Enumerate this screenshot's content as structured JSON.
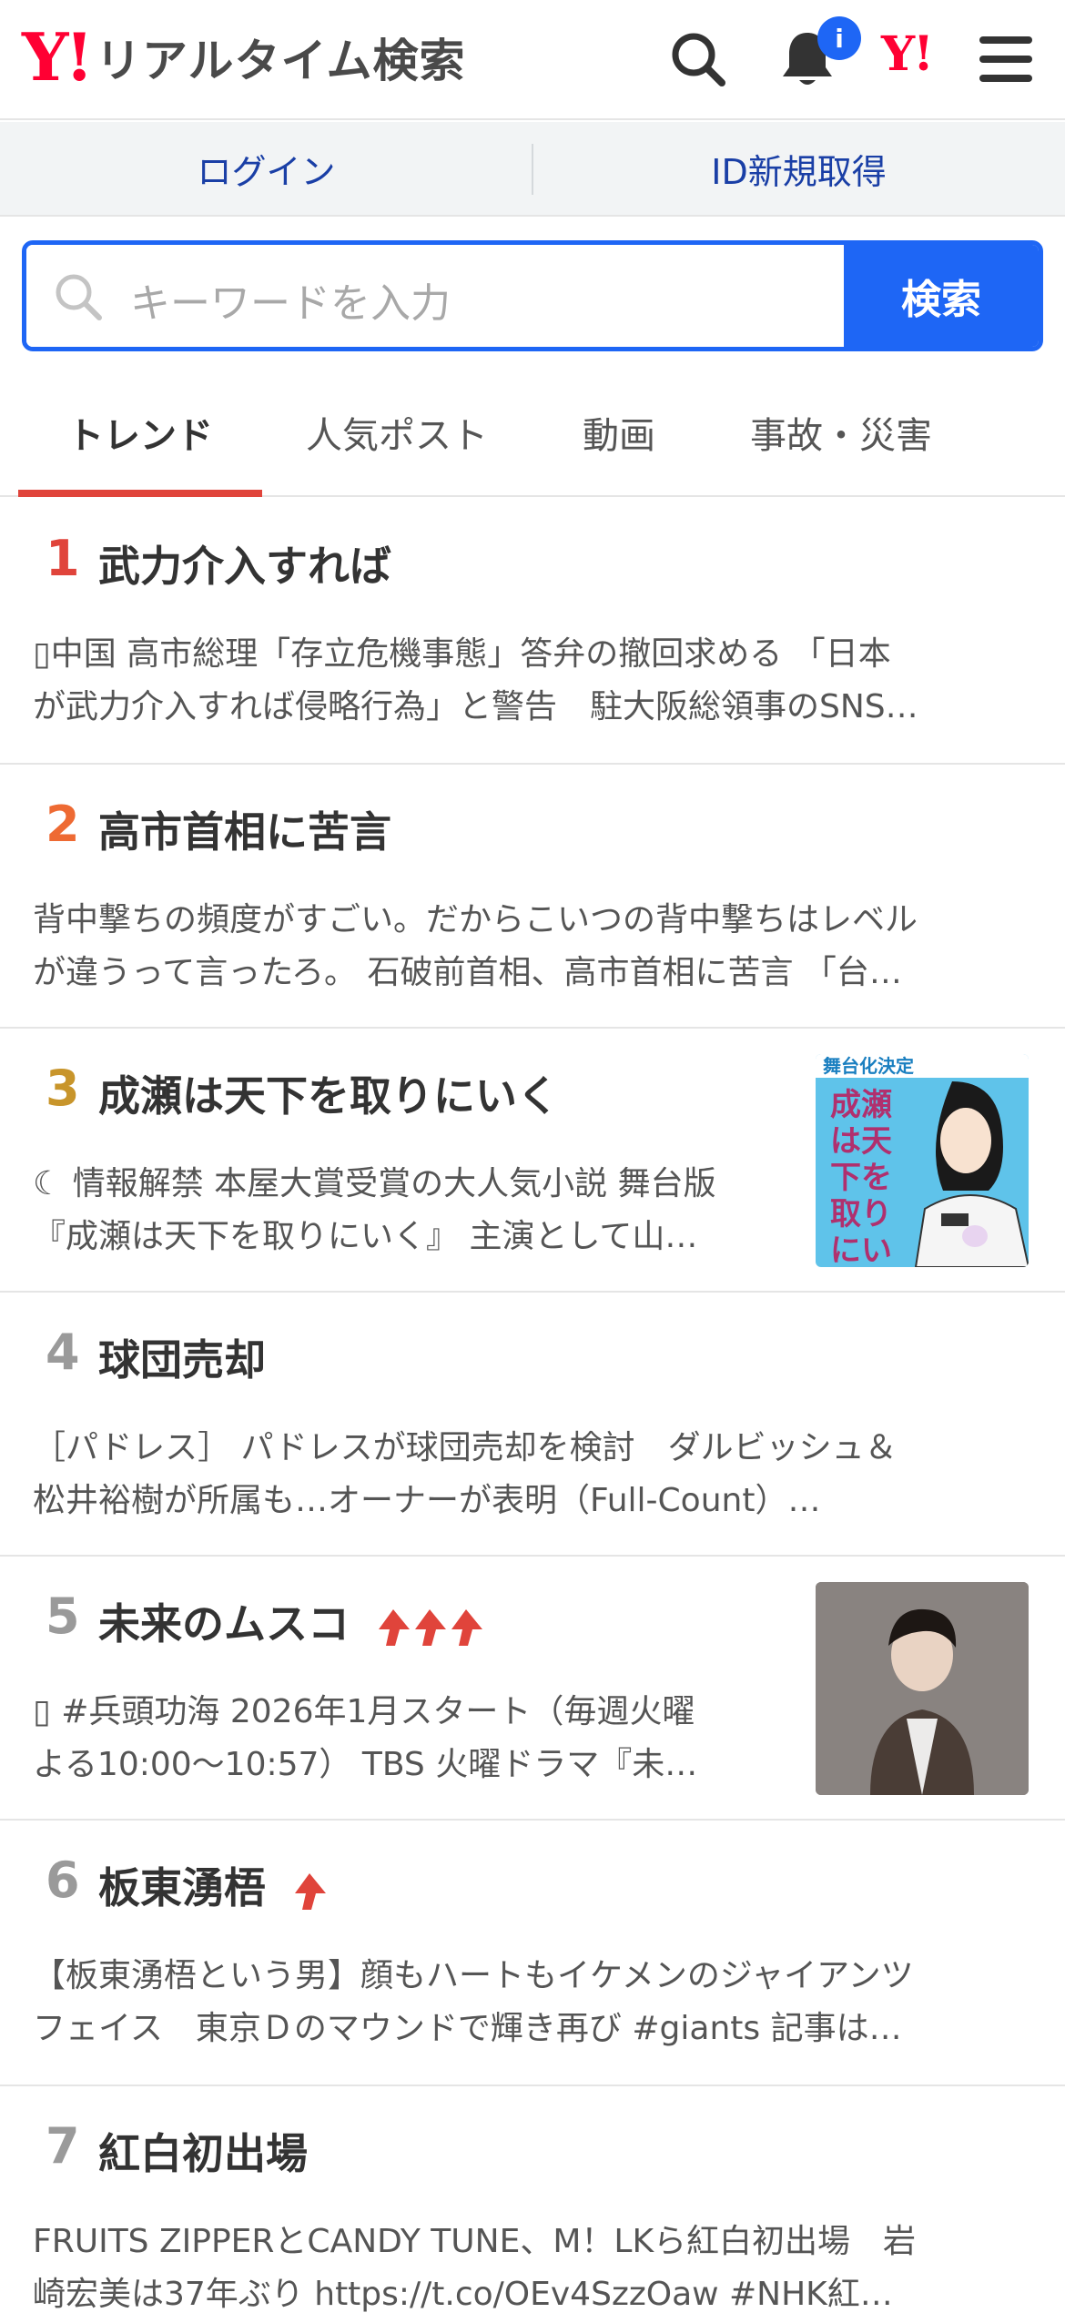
{
  "header": {
    "logo_mark": "Y!",
    "logo_text": "リアルタイム検索",
    "notification_badge": "i",
    "yahoo_mark": "Y!"
  },
  "account": {
    "login": "ログイン",
    "signup": "ID新規取得"
  },
  "search": {
    "placeholder": "キーワードを入力",
    "button": "検索"
  },
  "tabs": [
    {
      "label": "トレンド",
      "active": true
    },
    {
      "label": "人気ポスト"
    },
    {
      "label": "動画"
    },
    {
      "label": "事故・災害"
    }
  ],
  "colors": {
    "accent_blue": "#1e66f5",
    "rank1": "#e0443b",
    "rank2": "#ee6a33",
    "rank3": "#c8952b",
    "rank_default": "#9a9a9a",
    "arrow_red": "#e0443b"
  },
  "trends": [
    {
      "rank": "1",
      "title": "武力介入すれば",
      "line1": "▯中国 高市総理「存立危機事態」答弁の撤回求める 「日本",
      "line2": "が武力介入すれば侵略行為」と警告　駐大阪総領事のSNS…"
    },
    {
      "rank": "2",
      "title": "高市首相に苦言",
      "line1": "背中撃ちの頻度がすごい。だからこいつの背中撃ちはレベル",
      "line2": "が違うって言ったろ。 石破前首相、高市首相に苦言 「台…"
    },
    {
      "rank": "3",
      "title": "成瀬は天下を取りにいく",
      "line1": "☾ 情報解禁 本屋大賞受賞の大人気小説 舞台版",
      "line2": "『成瀬は天下を取りにいく』 主演として山…",
      "thumb_caption": "舞台化決定",
      "thumb_title": "成瀬は天下を取りにいく"
    },
    {
      "rank": "4",
      "title": "球団売却",
      "line1": "［パドレス］ パドレスが球団売却を検討　ダルビッシュ＆",
      "line2": "松井裕樹が所属も…オーナーが表明（Full-Count）…"
    },
    {
      "rank": "5",
      "title": "未来のムスコ",
      "trend_arrows": 3,
      "line1": "▯ #兵頭功海 2026年1月スタート（毎週火曜",
      "line2": "よる10:00〜10:57） TBS 火曜ドラマ『未…"
    },
    {
      "rank": "6",
      "title": "板東湧梧",
      "trend_arrows": 1,
      "line1": "【板東湧梧という男】顔もハートもイケメンのジャイアンツ",
      "line2": "フェイス　東京Ｄのマウンドで輝き再び #giants 記事は…"
    },
    {
      "rank": "7",
      "title": "紅白初出場",
      "line1": "FRUITS ZIPPERとCANDY TUNE、M！LKら紅白初出場　岩",
      "line2": "崎宏美は37年ぶり https://t.co/OEv4SzzOaw #NHK紅…"
    }
  ]
}
